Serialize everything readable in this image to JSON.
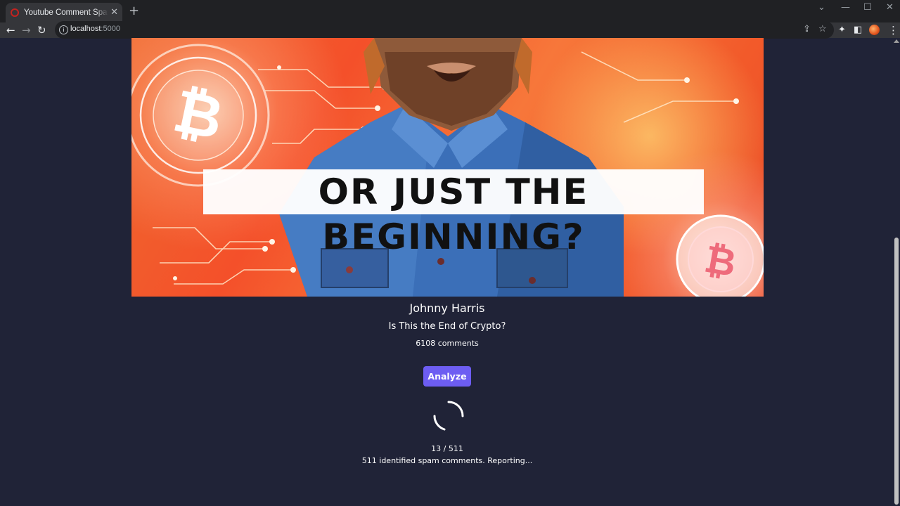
{
  "browser": {
    "tab_title": "Youtube Comment Spam Reporter",
    "url_host": "localhost",
    "url_port": ":5000"
  },
  "video": {
    "thumbnail_text": "OR JUST THE BEGINNING?",
    "channel": "Johnny Harris",
    "title": "Is This the End of Crypto?",
    "comment_count": "6108 comments"
  },
  "actions": {
    "analyze_label": "Analyze"
  },
  "progress": {
    "text": "13 / 511",
    "status": "511 identified spam comments. Reporting..."
  },
  "colors": {
    "page_bg": "#202337",
    "button_bg": "#6d5df2"
  }
}
